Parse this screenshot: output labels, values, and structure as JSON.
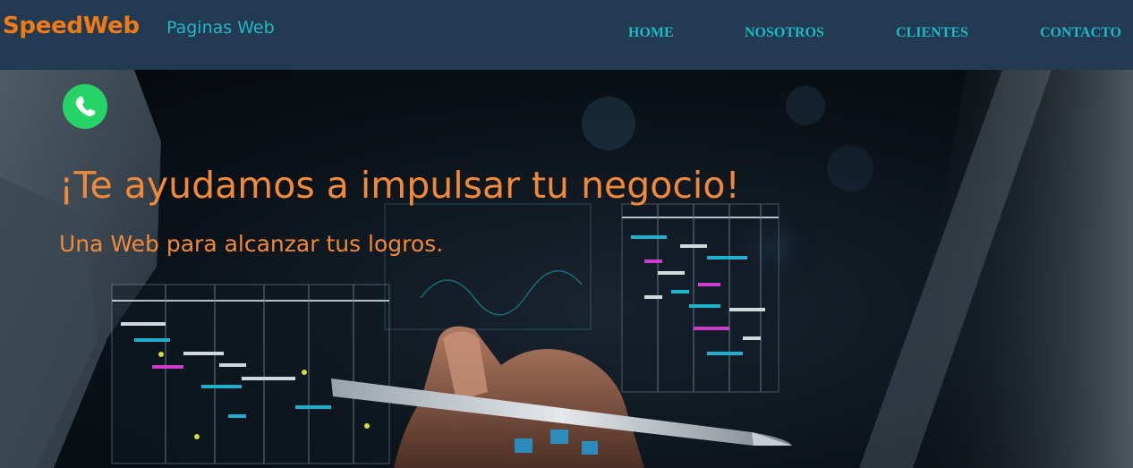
{
  "header": {
    "brand": "SpeedWeb",
    "tagline": "Paginas Web",
    "nav": [
      "HOME",
      "NOSOTROS",
      "CLIENTES",
      "CONTACTO"
    ]
  },
  "hero": {
    "headline": "¡Te ayudamos a impulsar tu negocio!",
    "subline": "Una Web para alcanzar tus logros.",
    "whatsapp_icon": "whatsapp-icon"
  },
  "colors": {
    "header_bg": "#223a52",
    "brand": "#f07a14",
    "nav": "#1fb8c6",
    "hero_text": "#f08a3a",
    "whatsapp": "#25d366"
  }
}
